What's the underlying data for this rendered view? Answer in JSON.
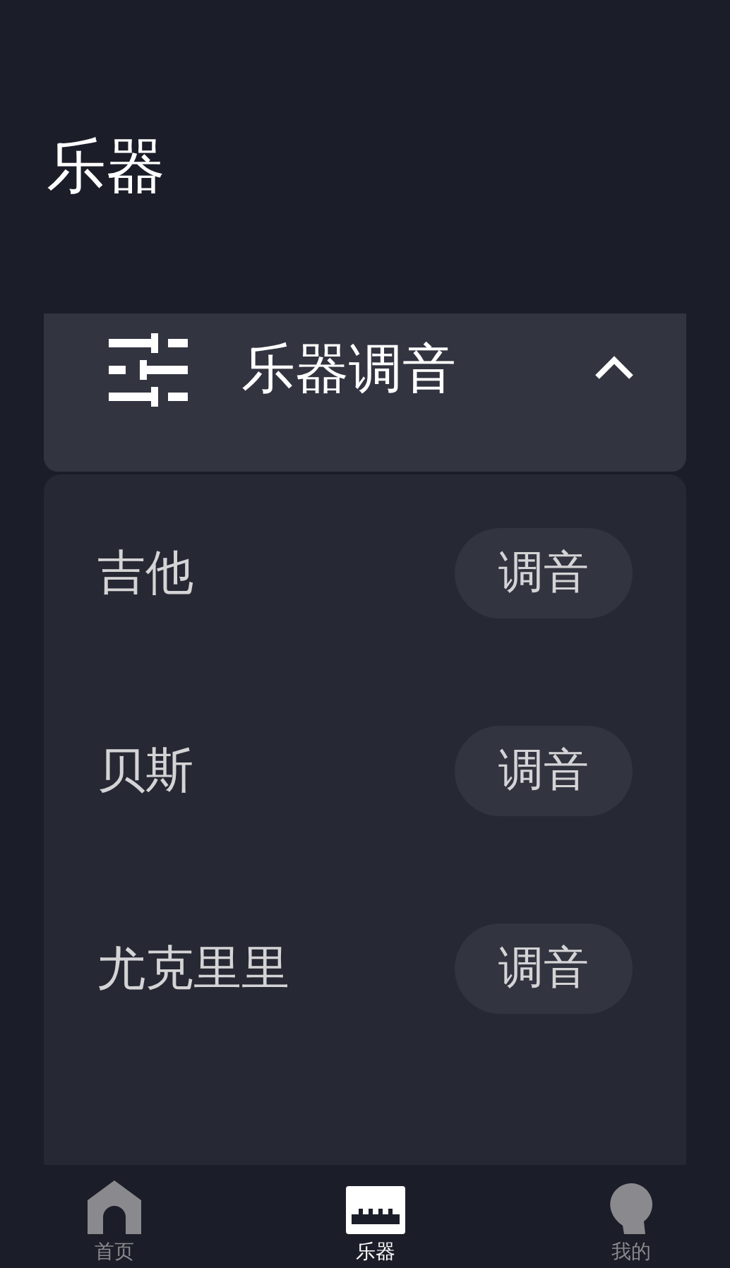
{
  "title": "乐器",
  "section": {
    "title": "乐器调音",
    "expanded": true
  },
  "instruments": [
    {
      "name": "吉他",
      "button": "调音"
    },
    {
      "name": "贝斯",
      "button": "调音"
    },
    {
      "name": "尤克里里",
      "button": "调音"
    }
  ],
  "tabs": [
    {
      "label": "首页",
      "kind": "home",
      "selected": false
    },
    {
      "label": "乐器",
      "kind": "instrument",
      "selected": true
    },
    {
      "label": "我的",
      "kind": "profile",
      "selected": false
    }
  ]
}
